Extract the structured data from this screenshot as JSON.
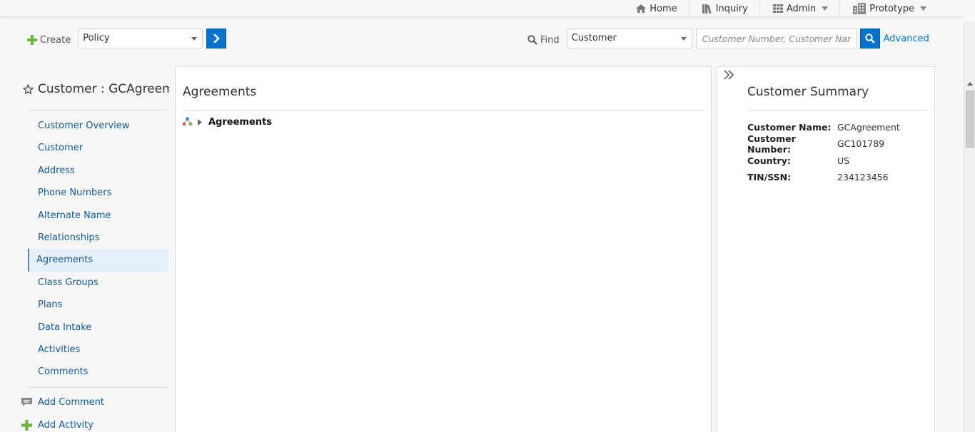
{
  "topnav": {
    "home": "Home",
    "inquiry": "Inquiry",
    "admin": "Admin",
    "prototype": "Prototype"
  },
  "toolbar": {
    "create_label": "Create",
    "create_type": "Policy",
    "find_label": "Find",
    "find_type": "Customer",
    "search_placeholder": "Customer Number, Customer Name",
    "advanced_label": "Advanced"
  },
  "sidebar": {
    "title": "Customer : GCAgreem...",
    "items": [
      {
        "label": "Customer Overview"
      },
      {
        "label": "Customer"
      },
      {
        "label": "Address"
      },
      {
        "label": "Phone Numbers"
      },
      {
        "label": "Alternate Name"
      },
      {
        "label": "Relationships"
      },
      {
        "label": "Agreements"
      },
      {
        "label": "Class Groups"
      },
      {
        "label": "Plans"
      },
      {
        "label": "Data Intake"
      },
      {
        "label": "Activities"
      },
      {
        "label": "Comments"
      }
    ],
    "active_index": 6,
    "add_comment": "Add Comment",
    "add_activity": "Add Activity"
  },
  "main": {
    "title": "Agreements",
    "tree_root": "Agreements"
  },
  "summary": {
    "title": "Customer Summary",
    "rows": [
      {
        "key": "Customer Name:",
        "value": "GCAgreement"
      },
      {
        "key": "Customer Number:",
        "value": "GC101789"
      },
      {
        "key": "Country:",
        "value": "US"
      },
      {
        "key": "TIN/SSN:",
        "value": "234123456"
      }
    ]
  },
  "colors": {
    "accent": "#0572ce",
    "link": "#0f5a9c",
    "active_bg": "#e6f0f9",
    "plus_green": "#6cb33f"
  }
}
